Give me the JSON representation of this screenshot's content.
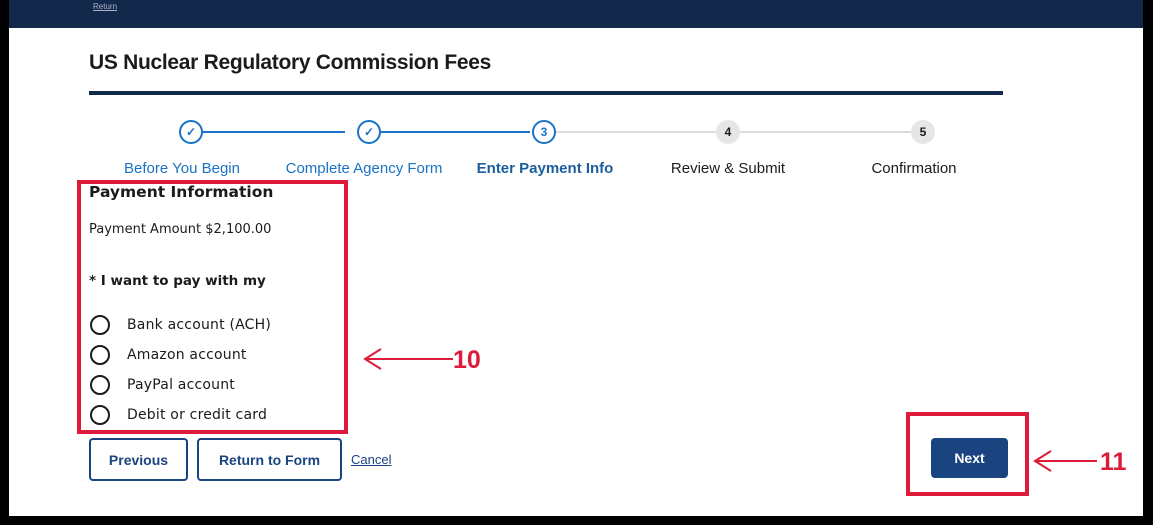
{
  "header": {
    "link_text": "Return"
  },
  "page": {
    "title": "US Nuclear Regulatory Commission Fees"
  },
  "stepper": {
    "steps": [
      {
        "number": "1",
        "label": "Before You Begin",
        "state": "completed",
        "icon": "check-icon"
      },
      {
        "number": "2",
        "label": "Complete Agency Form",
        "state": "completed",
        "icon": "check-icon"
      },
      {
        "number": "3",
        "label": "Enter Payment Info",
        "state": "current"
      },
      {
        "number": "4",
        "label": "Review & Submit",
        "state": "upcoming"
      },
      {
        "number": "5",
        "label": "Confirmation",
        "state": "upcoming"
      }
    ],
    "check_glyph": "✓"
  },
  "payment": {
    "heading": "Payment Information",
    "amount_text": "Payment Amount $2,100.00",
    "question": "* I want to pay with my",
    "options": [
      {
        "label": "Bank account (ACH)",
        "selected": false
      },
      {
        "label": "Amazon account",
        "selected": false
      },
      {
        "label": "PayPal account",
        "selected": false
      },
      {
        "label": "Debit or credit card",
        "selected": false
      }
    ]
  },
  "actions": {
    "previous_label": "Previous",
    "return_label": "Return to Form",
    "cancel_label": "Cancel",
    "next_label": "Next"
  },
  "annotations": [
    {
      "number": "10",
      "target": "payment options"
    },
    {
      "number": "11",
      "target": "next button"
    }
  ],
  "colors": {
    "navy": "#13294b",
    "primary_blue": "#1a4480",
    "step_blue": "#1a73c4",
    "annotation_red": "#dd1b3a"
  }
}
